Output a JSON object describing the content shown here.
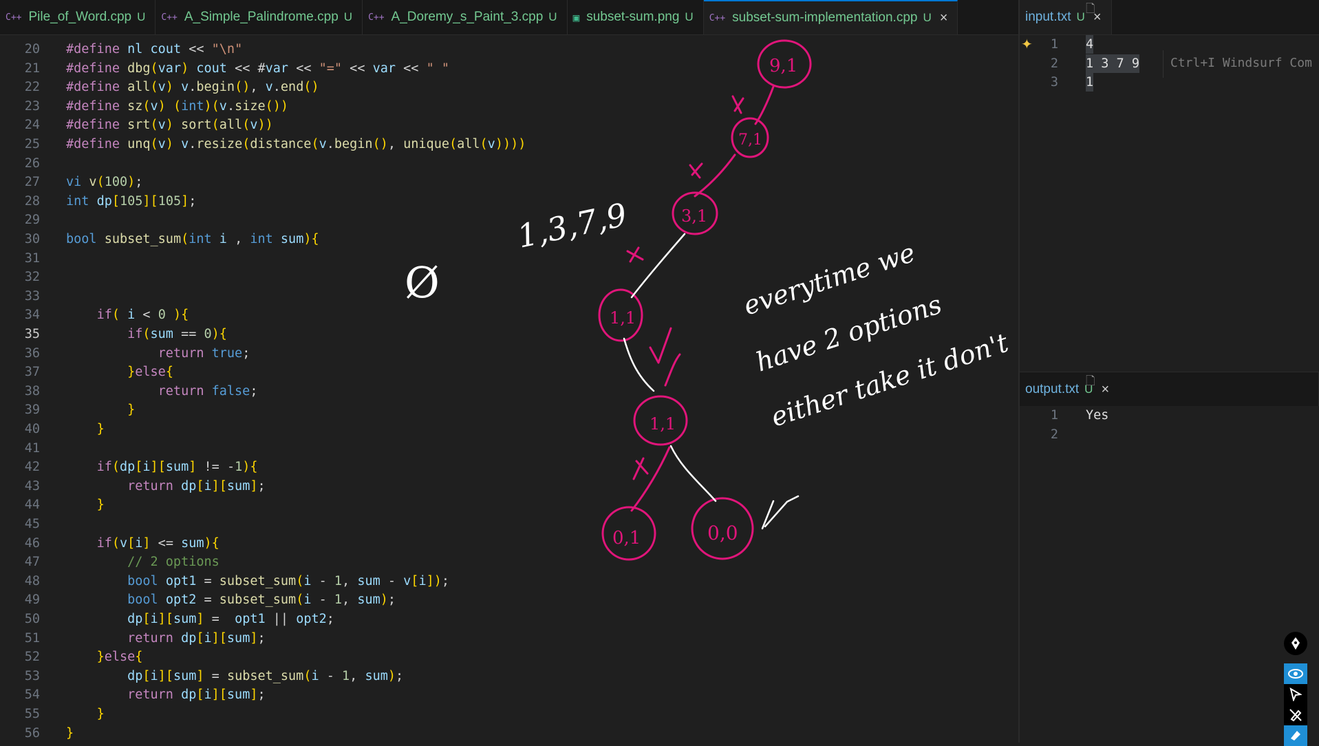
{
  "tabs": [
    {
      "label": "Pile_of_Word.cpp",
      "badge": "U",
      "type": "cpp",
      "active": false
    },
    {
      "label": "A_Simple_Palindrome.cpp",
      "badge": "U",
      "type": "cpp",
      "active": false
    },
    {
      "label": "A_Doremy_s_Paint_3.cpp",
      "badge": "U",
      "type": "cpp",
      "active": false
    },
    {
      "label": "subset-sum.png",
      "badge": "U",
      "type": "png",
      "active": false
    },
    {
      "label": "subset-sum-implementation.cpp",
      "badge": "U",
      "type": "cpp",
      "active": true
    }
  ],
  "right_tabs": {
    "input": {
      "label": "input.txt",
      "badge": "U"
    },
    "output": {
      "label": "output.txt",
      "badge": "U"
    }
  },
  "icons": {
    "cpp": "C++",
    "close": "×"
  },
  "editor": {
    "current_line": 35,
    "lines": [
      {
        "no": "20",
        "text": "#define nl cout << \"\\n\""
      },
      {
        "no": "21",
        "text": "#define dbg(var) cout << #var << \"=\" << var << \" \""
      },
      {
        "no": "22",
        "text": "#define all(v) v.begin(), v.end()"
      },
      {
        "no": "23",
        "text": "#define sz(v) (int)(v.size())"
      },
      {
        "no": "24",
        "text": "#define srt(v) sort(all(v))"
      },
      {
        "no": "25",
        "text": "#define unq(v) v.resize(distance(v.begin(), unique(all(v))))"
      },
      {
        "no": "26",
        "text": ""
      },
      {
        "no": "27",
        "text": "vi v(100);"
      },
      {
        "no": "28",
        "text": "int dp[105][105];"
      },
      {
        "no": "29",
        "text": ""
      },
      {
        "no": "30",
        "text": "bool subset_sum(int i , int sum){"
      },
      {
        "no": "31",
        "text": ""
      },
      {
        "no": "32",
        "text": ""
      },
      {
        "no": "33",
        "text": ""
      },
      {
        "no": "34",
        "text": "    if( i < 0 ){"
      },
      {
        "no": "35",
        "text": "        if(sum == 0){"
      },
      {
        "no": "36",
        "text": "            return true;"
      },
      {
        "no": "37",
        "text": "        }else{"
      },
      {
        "no": "38",
        "text": "            return false;"
      },
      {
        "no": "39",
        "text": "        }"
      },
      {
        "no": "40",
        "text": "    }"
      },
      {
        "no": "41",
        "text": ""
      },
      {
        "no": "42",
        "text": "    if(dp[i][sum] != -1){"
      },
      {
        "no": "43",
        "text": "        return dp[i][sum];"
      },
      {
        "no": "44",
        "text": "    }"
      },
      {
        "no": "45",
        "text": ""
      },
      {
        "no": "46",
        "text": "    if(v[i] <= sum){"
      },
      {
        "no": "47",
        "text": "        // 2 options"
      },
      {
        "no": "48",
        "text": "        bool opt1 = subset_sum(i - 1, sum - v[i]);"
      },
      {
        "no": "49",
        "text": "        bool opt2 = subset_sum(i - 1, sum);"
      },
      {
        "no": "50",
        "text": "        dp[i][sum] =  opt1 || opt2;"
      },
      {
        "no": "51",
        "text": "        return dp[i][sum];"
      },
      {
        "no": "52",
        "text": "    }else{"
      },
      {
        "no": "53",
        "text": "        dp[i][sum] = subset_sum(i - 1, sum);"
      },
      {
        "no": "54",
        "text": "        return dp[i][sum];"
      },
      {
        "no": "55",
        "text": "    }"
      },
      {
        "no": "56",
        "text": "}"
      }
    ]
  },
  "input_file": {
    "lines": [
      {
        "no": "1",
        "text": "4"
      },
      {
        "no": "2",
        "text": "1 3 7 9"
      },
      {
        "no": "3",
        "text": "1"
      }
    ],
    "inline_hint": "Ctrl+I Windsurf Com"
  },
  "output_file": {
    "lines": [
      {
        "no": "1",
        "text": "Yes"
      },
      {
        "no": "2",
        "text": ""
      }
    ]
  },
  "annotations": {
    "ink_color": "#e0157a",
    "white_ink": "#ffffff",
    "array_note": "1,3,7,9",
    "empty_set": "Ø",
    "nodes": [
      {
        "label": "9,1"
      },
      {
        "label": "7,1"
      },
      {
        "label": "3,1"
      },
      {
        "label": "1,1"
      },
      {
        "label": "1,1"
      },
      {
        "label": "0,1"
      },
      {
        "label": "0,0"
      }
    ],
    "note_lines": [
      "everytime we",
      "have 2 options",
      "either take it don't"
    ]
  },
  "pen_toolbar": [
    "pen-nib-icon",
    "eye-icon",
    "pointer-icon",
    "pen-slash-icon",
    "highlighter-icon"
  ]
}
